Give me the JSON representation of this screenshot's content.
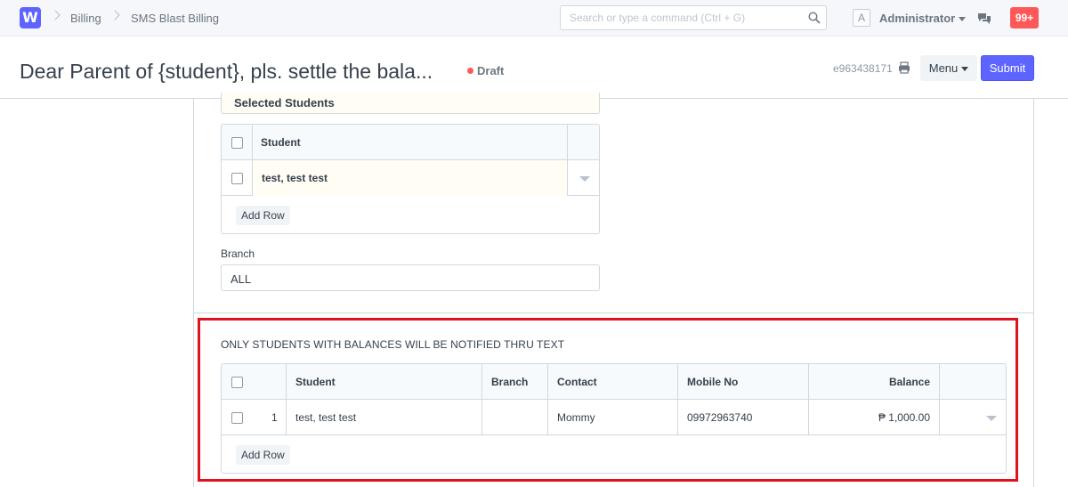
{
  "navbar": {
    "logo_letter": "W",
    "breadcrumbs": [
      "Billing",
      "SMS Blast Billing"
    ],
    "search_placeholder": "Search or type a command (Ctrl + G)",
    "avatar_letter": "A",
    "user_name": "Administrator",
    "notification_count": "99+"
  },
  "header": {
    "title": "Dear Parent of {student}, pls. settle the bala...",
    "status": "Draft",
    "status_color": "#ff5858",
    "doc_id": "e963438171",
    "menu_label": "Menu",
    "submit_label": "Submit",
    "accent_color": "#5e64ff"
  },
  "selected_students": {
    "section_label": "Selected Students",
    "column_header": "Student",
    "rows": [
      {
        "student": "test, test test"
      }
    ],
    "add_row_label": "Add Row"
  },
  "branch": {
    "label": "Branch",
    "value": "ALL"
  },
  "balances": {
    "notice": "ONLY STUDENTS WITH BALANCES WILL BE NOTIFIED THRU TEXT",
    "columns": [
      "Student",
      "Branch",
      "Contact",
      "Mobile No",
      "Balance"
    ],
    "rows": [
      {
        "idx": "1",
        "student": "test, test test",
        "branch": "",
        "contact": "Mommy",
        "mobile_no": "09972963740",
        "balance": "₱ 1,000.00"
      }
    ],
    "add_row_label": "Add Row",
    "highlight_color": "#e0121f"
  }
}
